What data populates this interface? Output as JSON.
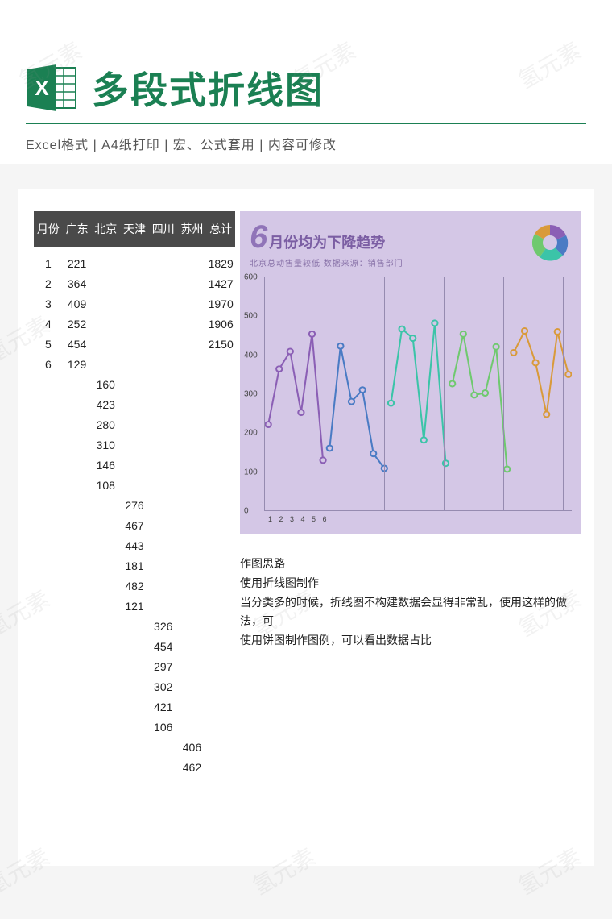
{
  "header": {
    "title": "多段式折线图",
    "meta": "Excel格式 |  A4纸打印 | 宏、公式套用 | 内容可修改"
  },
  "watermark": "氢元素",
  "table": {
    "headers": [
      "月份",
      "广东",
      "北京",
      "天津",
      "四川",
      "苏州",
      "总计"
    ],
    "guangdong": [
      {
        "m": "1",
        "v": "221",
        "t": "1829"
      },
      {
        "m": "2",
        "v": "364",
        "t": "1427"
      },
      {
        "m": "3",
        "v": "409",
        "t": "1970"
      },
      {
        "m": "4",
        "v": "252",
        "t": "1906"
      },
      {
        "m": "5",
        "v": "454",
        "t": "2150"
      },
      {
        "m": "6",
        "v": "129",
        "t": ""
      }
    ],
    "beijing": [
      "160",
      "423",
      "280",
      "310",
      "146",
      "108"
    ],
    "tianjin": [
      "276",
      "467",
      "443",
      "181",
      "482",
      "121"
    ],
    "sichuan": [
      "326",
      "454",
      "297",
      "302",
      "421",
      "106"
    ],
    "suzhou": [
      "406",
      "462"
    ]
  },
  "chart_data": {
    "type": "line",
    "title_big": "6",
    "title_rest": "月份均为下降趋势",
    "subtitle": "北京总动售量较低   数据来源：销售部门",
    "ylim": [
      0,
      600
    ],
    "yticks": [
      0,
      100,
      200,
      300,
      400,
      500,
      600
    ],
    "xlabels": "1 2 3 4 5 6",
    "pie_segments": [
      "广东",
      "北京",
      "天津",
      "四川",
      "苏州"
    ],
    "series": [
      {
        "name": "广东",
        "color": "#8b5fb5",
        "values": [
          221,
          364,
          409,
          252,
          454,
          129
        ]
      },
      {
        "name": "北京",
        "color": "#4a7bc4",
        "values": [
          160,
          423,
          280,
          310,
          146,
          108
        ]
      },
      {
        "name": "天津",
        "color": "#3bc4a8",
        "values": [
          276,
          467,
          443,
          181,
          482,
          121
        ]
      },
      {
        "name": "四川",
        "color": "#6fc96f",
        "values": [
          326,
          454,
          297,
          302,
          421,
          106
        ]
      },
      {
        "name": "苏州",
        "color": "#d99a3a",
        "values": [
          406,
          462,
          380,
          247,
          460,
          350
        ]
      }
    ]
  },
  "notes": {
    "l1": "作图思路",
    "l2": "使用折线图制作",
    "l3": "当分类多的时候，折线图不构建数据会显得非常乱，使用这样的做法，可",
    "l4": "使用饼图制作图例，可以看出数据占比"
  }
}
